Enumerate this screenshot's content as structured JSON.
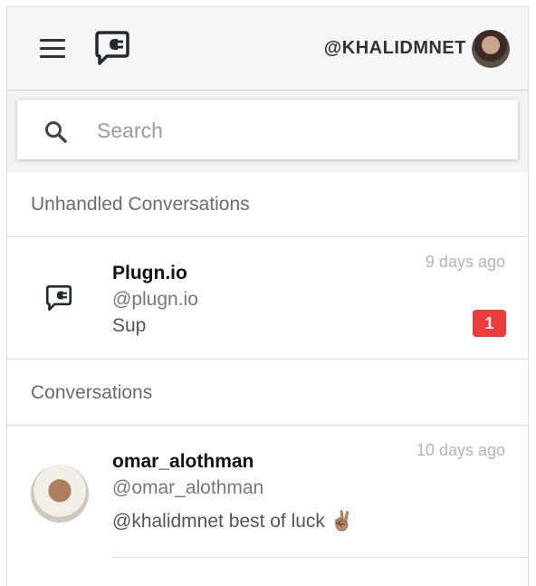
{
  "header": {
    "menu_icon": "hamburger-menu-icon",
    "logo_icon": "plug-chat-logo-icon",
    "username": "@KHALIDMNET"
  },
  "search": {
    "icon": "search-icon",
    "placeholder": "Search",
    "value": ""
  },
  "sections": {
    "unhandled_title": "Unhandled Conversations",
    "conversations_title": "Conversations"
  },
  "unhandled": [
    {
      "name": "Plugn.io",
      "handle": "@plugn.io",
      "message": "Sup",
      "time": "9 days ago",
      "unread_count": "1",
      "icon": "plug-chat-logo-icon"
    }
  ],
  "conversations": [
    {
      "name": "omar_alothman",
      "handle": "@omar_alothman",
      "message": "@khalidmnet best of luck ✌🏽",
      "time": "10 days ago"
    }
  ],
  "colors": {
    "badge": "#ee3b3b",
    "header_bg": "#f6f6f6"
  }
}
